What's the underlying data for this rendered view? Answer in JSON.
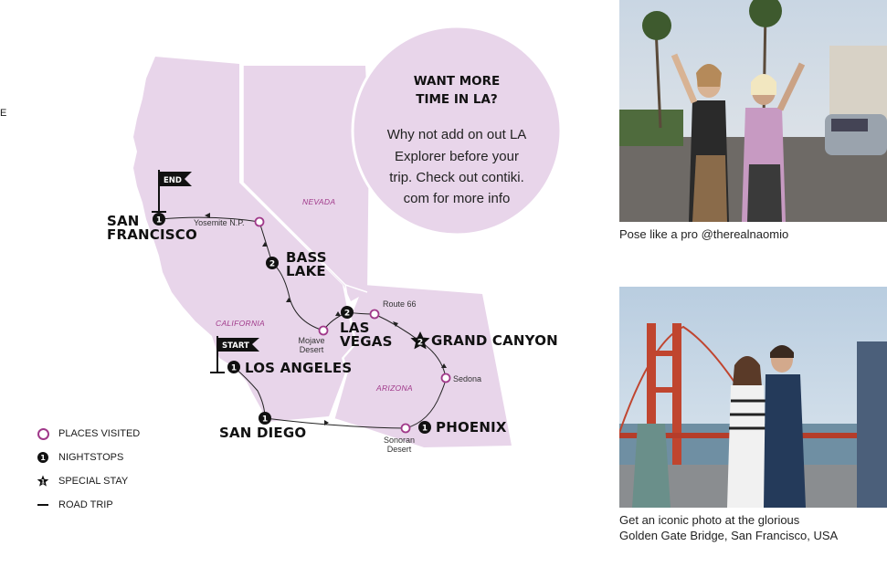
{
  "edge_text": "E",
  "callout": {
    "title_line1": "WANT MORE",
    "title_line2": "TIME IN LA?",
    "body_line1": "Why not add on out LA",
    "body_line2": "Explorer before your",
    "body_line3": "trip. Check out contiki.",
    "body_line4": "com for more info"
  },
  "states": {
    "nevada": "NEVADA",
    "california": "CALIFORNIA",
    "arizona": "ARIZONA"
  },
  "flags": {
    "end": "END",
    "start": "START"
  },
  "cities": {
    "san_francisco_1": "SAN",
    "san_francisco_2": "FRANCISCO",
    "san_francisco_nights": "1",
    "bass_lake_1": "BASS",
    "bass_lake_2": "LAKE",
    "bass_lake_nights": "2",
    "las_vegas_1": "LAS",
    "las_vegas_2": "VEGAS",
    "las_vegas_nights": "2",
    "grand_canyon": "GRAND CANYON",
    "grand_canyon_nights": "2",
    "los_angeles": "LOS ANGELES",
    "los_angeles_nights": "1",
    "san_diego": "SAN DIEGO",
    "san_diego_nights": "1",
    "phoenix": "PHOENIX",
    "phoenix_nights": "1"
  },
  "places": {
    "yosemite": "Yosemite N.P.",
    "route66": "Route 66",
    "mojave_1": "Mojave",
    "mojave_2": "Desert",
    "sedona": "Sedona",
    "sonoran_1": "Sonoran",
    "sonoran_2": "Desert"
  },
  "legend": {
    "places_visited": "PLACES VISITED",
    "nightstops": "NIGHTSTOPS",
    "special_stay": "SPECIAL STAY",
    "road_trip": "ROAD TRIP"
  },
  "photos": {
    "photo1_caption": "Pose like a pro @therealnaomio",
    "photo2_caption_line1": "Get an iconic photo at the glorious",
    "photo2_caption_line2": "Golden Gate Bridge, San Francisco, USA"
  },
  "colors": {
    "map_fill": "#e8d5ea",
    "accent": "#a0398a",
    "callout_fill": "#e8d5ea"
  }
}
